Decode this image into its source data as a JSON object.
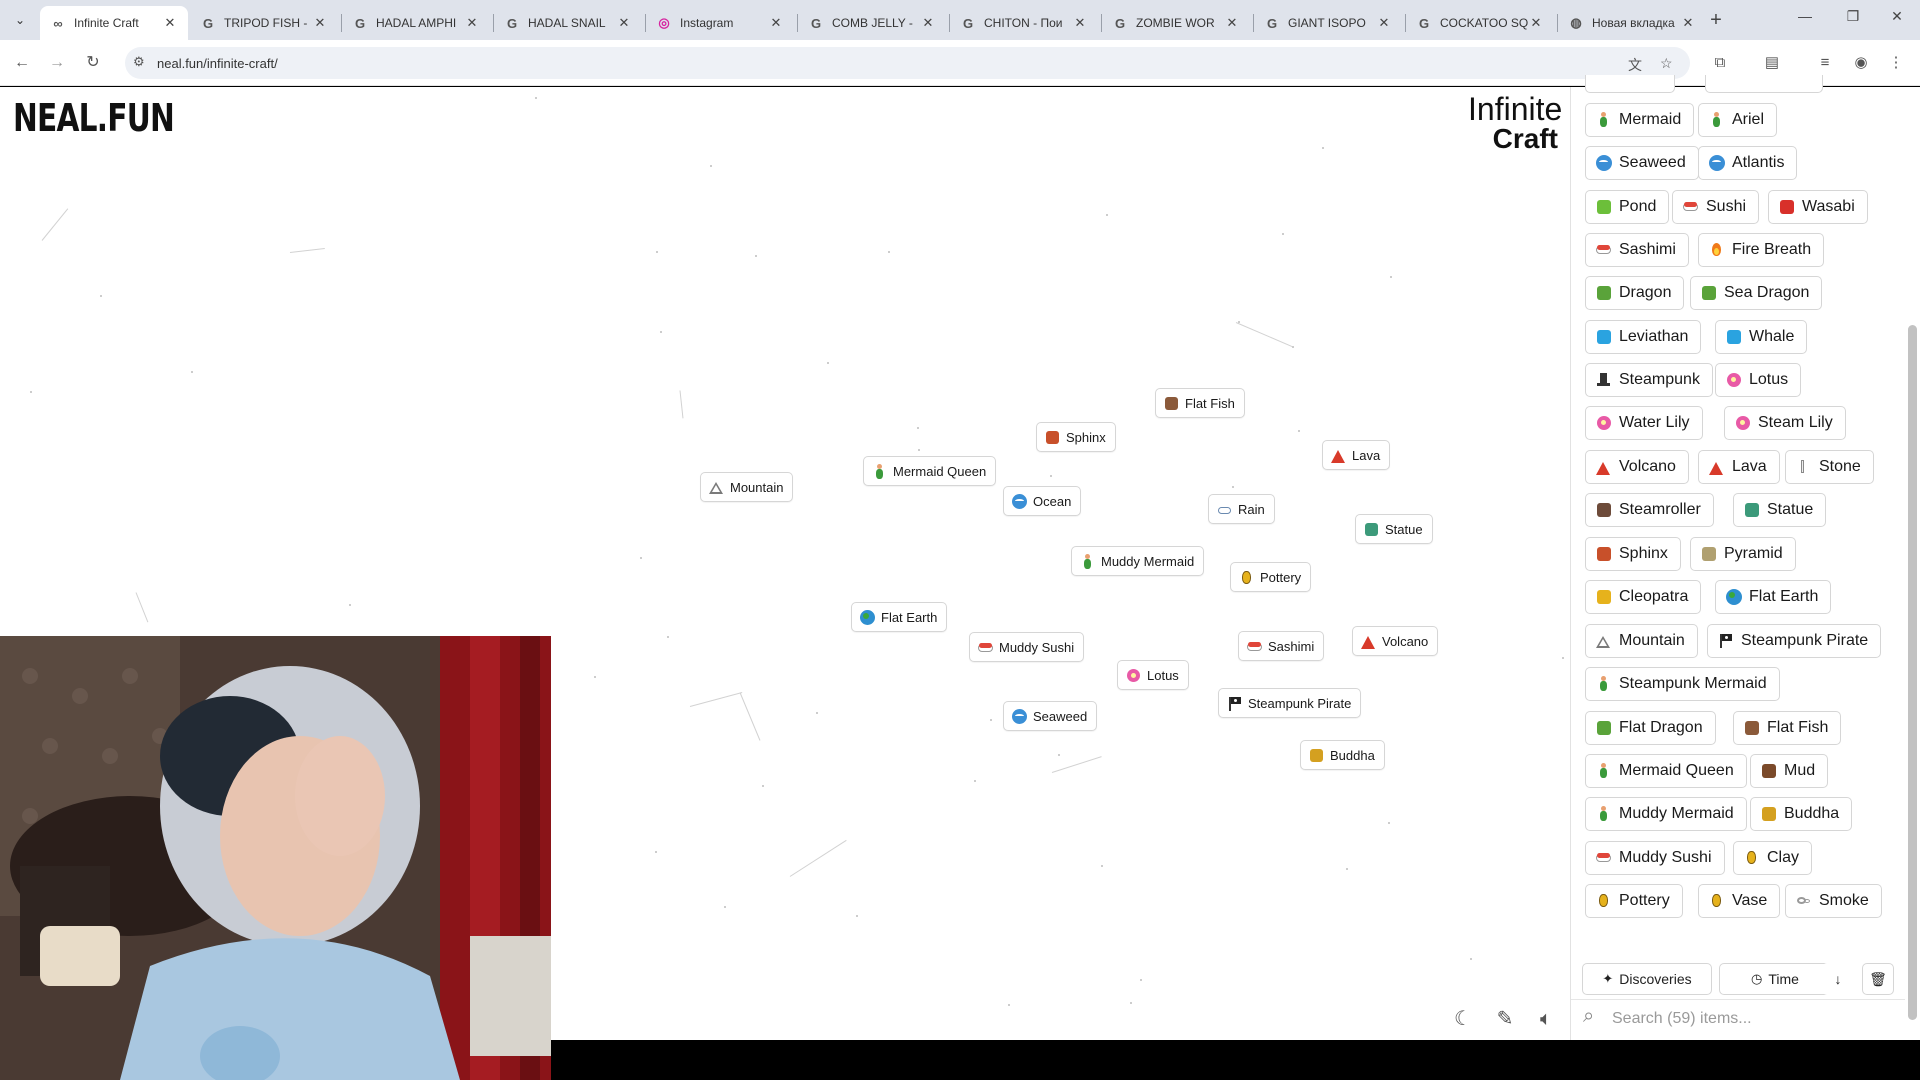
{
  "browser": {
    "tabs": [
      {
        "label": "Infinite Craft",
        "favicon": "infinity-icon",
        "active": true
      },
      {
        "label": "TRIPOD FISH - ",
        "favicon": "google-icon"
      },
      {
        "label": "HADAL AMPHI",
        "favicon": "google-icon"
      },
      {
        "label": "HADAL SNAIL",
        "favicon": "google-icon"
      },
      {
        "label": "Instagram",
        "favicon": "instagram-icon"
      },
      {
        "label": "COMB JELLY - ",
        "favicon": "google-icon"
      },
      {
        "label": "CHITON - Пои",
        "favicon": "google-icon"
      },
      {
        "label": "ZOMBIE WOR",
        "favicon": "google-icon"
      },
      {
        "label": "GIANT ISOPO",
        "favicon": "google-icon"
      },
      {
        "label": "COCKATOO SQ",
        "favicon": "google-icon"
      },
      {
        "label": "Новая вкладка",
        "favicon": "chrome-icon"
      }
    ],
    "url": "neal.fun/infinite-craft/"
  },
  "page": {
    "logo": "NEAL.FUN",
    "title_line1": "Infinite",
    "title_line2": "Craft"
  },
  "canvas_items": [
    {
      "label": "Flat Fish",
      "icon": "plate"
    },
    {
      "label": "Sphinx",
      "icon": "sphinx"
    },
    {
      "label": "Mermaid Queen",
      "icon": "mermaid"
    },
    {
      "label": "Lava",
      "icon": "volcano"
    },
    {
      "label": "Mountain",
      "icon": "mountain"
    },
    {
      "label": "Ocean",
      "icon": "wave"
    },
    {
      "label": "Rain",
      "icon": "cloud"
    },
    {
      "label": "Statue",
      "icon": "statue"
    },
    {
      "label": "Muddy Mermaid",
      "icon": "mermaid"
    },
    {
      "label": "Pottery",
      "icon": "pot"
    },
    {
      "label": "Flat Earth",
      "icon": "globe"
    },
    {
      "label": "Muddy Sushi",
      "icon": "sushi"
    },
    {
      "label": "Sashimi",
      "icon": "sushi"
    },
    {
      "label": "Volcano",
      "icon": "volcano"
    },
    {
      "label": "Lotus",
      "icon": "flower"
    },
    {
      "label": "Steampunk Pirate",
      "icon": "flag"
    },
    {
      "label": "Seaweed",
      "icon": "wave"
    },
    {
      "label": "Buddha",
      "icon": "buddha"
    }
  ],
  "sidebar": {
    "items": [
      {
        "label": "Mermaid",
        "icon": "mermaid"
      },
      {
        "label": "Ariel",
        "icon": "mermaid"
      },
      {
        "label": "Seaweed",
        "icon": "wave"
      },
      {
        "label": "Atlantis",
        "icon": "wave"
      },
      {
        "label": "Pond",
        "icon": "frog"
      },
      {
        "label": "Sushi",
        "icon": "sushi"
      },
      {
        "label": "Wasabi",
        "icon": "pepper"
      },
      {
        "label": "Sashimi",
        "icon": "sushi"
      },
      {
        "label": "Fire Breath",
        "icon": "fire"
      },
      {
        "label": "Dragon",
        "icon": "dragon"
      },
      {
        "label": "Sea Dragon",
        "icon": "dragon"
      },
      {
        "label": "Leviathan",
        "icon": "whale"
      },
      {
        "label": "Whale",
        "icon": "whale"
      },
      {
        "label": "Steampunk",
        "icon": "tophat"
      },
      {
        "label": "Lotus",
        "icon": "flower"
      },
      {
        "label": "Water Lily",
        "icon": "flower"
      },
      {
        "label": "Steam Lily",
        "icon": "flower"
      },
      {
        "label": "Volcano",
        "icon": "volcano"
      },
      {
        "label": "Lava",
        "icon": "volcano"
      },
      {
        "label": "Stone",
        "icon": "stone"
      },
      {
        "label": "Steamroller",
        "icon": "roller"
      },
      {
        "label": "Statue",
        "icon": "statue"
      },
      {
        "label": "Sphinx",
        "icon": "sphinx"
      },
      {
        "label": "Pyramid",
        "icon": "pyramid"
      },
      {
        "label": "Cleopatra",
        "icon": "crown"
      },
      {
        "label": "Flat Earth",
        "icon": "globe"
      },
      {
        "label": "Mountain",
        "icon": "mountain"
      },
      {
        "label": "Steampunk Pirate",
        "icon": "flag"
      },
      {
        "label": "Steampunk Mermaid",
        "icon": "mermaid"
      },
      {
        "label": "Flat Dragon",
        "icon": "dragon"
      },
      {
        "label": "Flat Fish",
        "icon": "plate"
      },
      {
        "label": "Mermaid Queen",
        "icon": "mermaid"
      },
      {
        "label": "Mud",
        "icon": "mud"
      },
      {
        "label": "Muddy Mermaid",
        "icon": "mermaid"
      },
      {
        "label": "Buddha",
        "icon": "buddha"
      },
      {
        "label": "Muddy Sushi",
        "icon": "sushi"
      },
      {
        "label": "Clay",
        "icon": "pot"
      },
      {
        "label": "Pottery",
        "icon": "pot"
      },
      {
        "label": "Vase",
        "icon": "pot"
      },
      {
        "label": "Smoke",
        "icon": "smoke"
      }
    ],
    "sort_discoveries": "Discoveries",
    "sort_time": "Time",
    "search_placeholder": "Search (59) items..."
  },
  "colors": {
    "mermaid": "#3b9a3b",
    "wave": "#3a8fd6",
    "sushi": "#e0463a",
    "volcano": "#d83a2a",
    "pot": "#e6b21c",
    "globe": "#2e8fd0",
    "flower": "#e85aa6",
    "dragon": "#5aa33a",
    "whale": "#2aa3e0",
    "fire": "#f07a1a",
    "frog": "#6cbf3a",
    "pepper": "#d8302a",
    "tophat": "#333333",
    "stone": "#8a8a8a",
    "roller": "#6d4b3a",
    "statue": "#3c9a7a",
    "sphinx": "#c8502a",
    "pyramid": "#b0a070",
    "crown": "#e6b21c",
    "mountain": "#7a7a7a",
    "flag": "#222222",
    "plate": "#8b5a3a",
    "mud": "#7b4a2a",
    "buddha": "#d4a020",
    "smoke": "#9a9a9a",
    "cloud": "#6a8ab0"
  }
}
